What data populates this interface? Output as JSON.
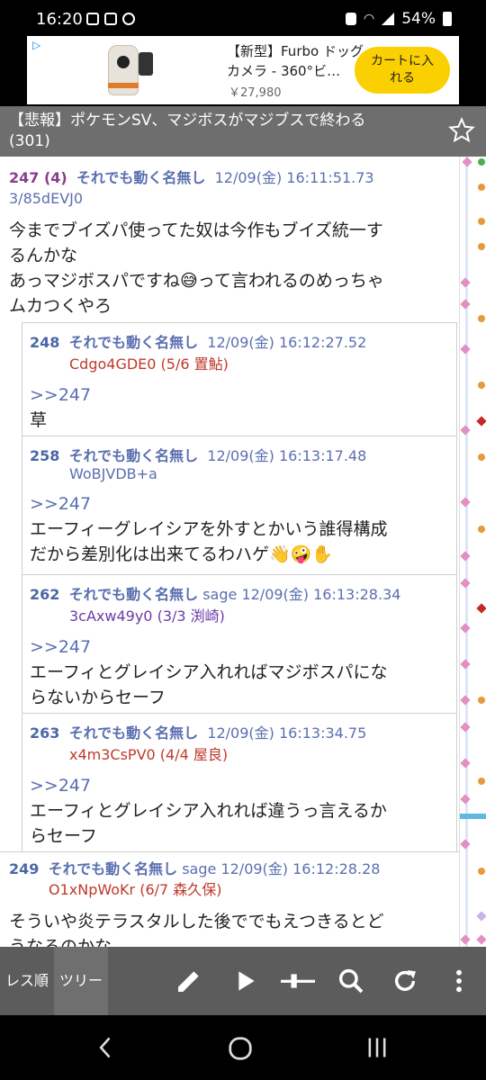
{
  "status_bar": {
    "time": "16:20",
    "battery": "54%"
  },
  "ad": {
    "choice": "▷",
    "title": "【新型】Furbo ドッグカメラ - 360°ビ…",
    "price": "￥27,980",
    "button": "カートに入れる"
  },
  "thread": {
    "title": "【悲報】ポケモンSV、マジボスがマジブスで終わる",
    "count": "(301)"
  },
  "posts": [
    {
      "num": "247 (4)",
      "name": "それでも動く名無し",
      "sage": "",
      "date": "12/09(金) 16:11:51.73",
      "id": "3/85dEVJ0",
      "lines": [
        "今までブイズパ使ってた奴は今作もブイズ統一す",
        "るんかな",
        "あっマジボスパですね😅って言われるのめっちゃ",
        "ムカつくやろ"
      ]
    },
    {
      "num": "248",
      "name": "それでも動く名無し",
      "sage": "",
      "date": "12/09(金) 16:12:27.52",
      "id": "Cdgo4GDE0 (5/6 置鮎)",
      "anchor": ">>247",
      "lines": [
        "草"
      ]
    },
    {
      "num": "258",
      "name": "それでも動く名無し",
      "sage": "",
      "date": "12/09(金) 16:13:17.48",
      "id": "WoBJVDB+a",
      "anchor": ">>247",
      "lines": [
        "エーフィーグレイシアを外すとかいう誰得構成",
        "だから差別化は出来てるわハゲ👋🤪✋"
      ]
    },
    {
      "num": "262",
      "name": "それでも動く名無し",
      "sage": "sage",
      "date": "12/09(金) 16:13:28.34",
      "id": "3cAxw49y0 (3/3 渕崎)",
      "anchor": ">>247",
      "lines": [
        "エーフィとグレイシア入れればマジボスパにな",
        "らないからセーフ"
      ]
    },
    {
      "num": "263",
      "name": "それでも動く名無し",
      "sage": "",
      "date": "12/09(金) 16:13:34.75",
      "id": "x4m3CsPV0 (4/4 屋良)",
      "anchor": ">>247",
      "lines": [
        "エーフィとグレイシア入れれば違うっ言えるか",
        "らセーフ"
      ]
    },
    {
      "num": "249",
      "name": "それでも動く名無し",
      "sage": "sage",
      "date": "12/09(金) 16:12:28.28",
      "id": "O1xNpWoKr (6/7 森久保)",
      "lines": [
        "そういや炎テラスタルした後ででもえつきるとど",
        "うなるのかな"
      ]
    }
  ],
  "toolbar": {
    "tab_order": "レス順",
    "tab_tree": "ツリー"
  },
  "colors": {
    "accent": "#5a6fb0",
    "post_num": "#8a3d8a",
    "header_bg": "#6e6e6e",
    "toolbar_bg": "#5c5c5c"
  }
}
